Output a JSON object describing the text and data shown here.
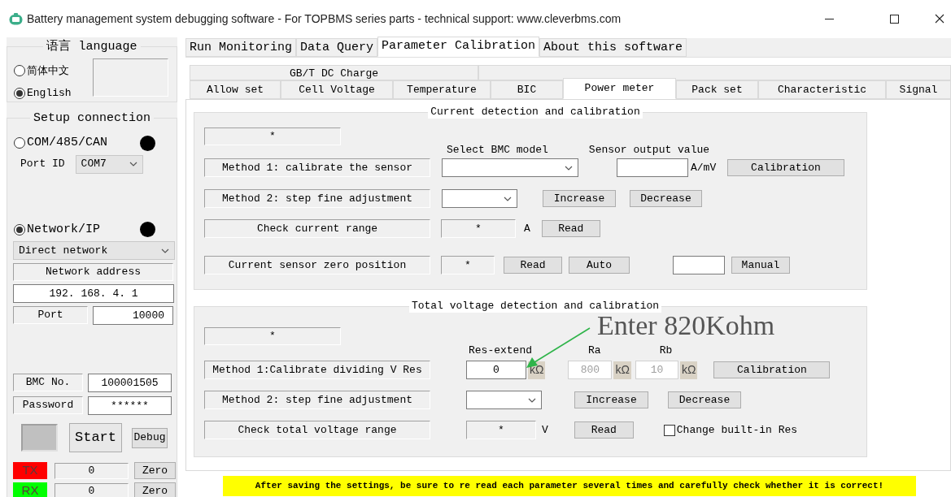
{
  "window": {
    "title": "Battery management system debugging software - For TOPBMS series parts - technical support: www.cleverbms.com"
  },
  "language": {
    "title": "语言 language",
    "options": [
      {
        "label": "简体中文",
        "selected": false
      },
      {
        "label": "English",
        "selected": true
      }
    ]
  },
  "connection": {
    "title": "Setup connection",
    "modes": [
      {
        "label": "COM/485/CAN",
        "selected": false
      },
      {
        "label": "Network/IP",
        "selected": true
      }
    ],
    "port_id_label": "Port ID",
    "port_id": "COM7",
    "network_type": "Direct network",
    "network_address_label": "Network address",
    "network_address": "192. 168. 4. 1",
    "port_label": "Port",
    "port": "10000",
    "bmc_no_label": "BMC No.",
    "bmc_no": "100001505",
    "password_label": "Password",
    "password": "******",
    "start": "Start",
    "debug": "Debug",
    "counters": [
      {
        "label": "TX",
        "color": "#ff0000",
        "value": "0",
        "button": "Zero"
      },
      {
        "label": "RX",
        "color": "#00ff00",
        "value": "0",
        "button": "Zero"
      }
    ]
  },
  "tabs": [
    {
      "label": "Run Monitoring",
      "selected": false
    },
    {
      "label": "Data Query",
      "selected": false
    },
    {
      "label": "Parameter Calibration",
      "selected": true
    },
    {
      "label": "About this software",
      "selected": false
    }
  ],
  "subtabs_top": [
    {
      "label": "GB/T DC Charge",
      "selected": false
    }
  ],
  "subtabs": [
    {
      "label": "Allow set",
      "selected": false
    },
    {
      "label": "Cell Voltage",
      "selected": false
    },
    {
      "label": "Temperature",
      "selected": false
    },
    {
      "label": "BIC",
      "selected": false
    },
    {
      "label": "Power meter",
      "selected": true
    },
    {
      "label": "Pack set",
      "selected": false
    },
    {
      "label": "Characteristic",
      "selected": false
    },
    {
      "label": "Signal",
      "selected": false
    }
  ],
  "current": {
    "title": "Current detection and calibration",
    "status": "*",
    "model_label": "Select BMC model",
    "sensor_label": "Sensor output value",
    "method1": {
      "label": "Method 1: calibrate the sensor",
      "unit": "A/mV",
      "button": "Calibration"
    },
    "method2": {
      "label": "Method 2: step fine adjustment",
      "increase": "Increase",
      "decrease": "Decrease"
    },
    "range": {
      "label": "Check current range",
      "value": "*",
      "unit": "A",
      "button": "Read"
    },
    "zero": {
      "label": "Current sensor zero position",
      "value": "*",
      "read": "Read",
      "auto": "Auto",
      "manual": "Manual"
    }
  },
  "voltage": {
    "title": "Total voltage detection and calibration",
    "status": "*",
    "res_extend_label": "Res-extend",
    "ra_label": "Ra",
    "rb_label": "Rb",
    "method1": {
      "label": "Method 1:Calibrate dividing V Res",
      "res_extend": {
        "value": "0",
        "unit": "kΩ",
        "disabled": false
      },
      "ra": {
        "value": "800",
        "unit": "kΩ",
        "disabled": true
      },
      "rb": {
        "value": "10",
        "unit": "kΩ",
        "disabled": true
      },
      "button": "Calibration"
    },
    "method2": {
      "label": "Method 2: step fine adjustment",
      "increase": "Increase",
      "decrease": "Decrease"
    },
    "range": {
      "label": "Check total voltage range",
      "value": "*",
      "unit": "V",
      "button": "Read"
    },
    "builtin": {
      "label": "Change built-in Res",
      "checked": false
    }
  },
  "annotation": {
    "text": "Enter 820Kohm"
  },
  "notice": "After saving the settings, be sure to re read each parameter several times and carefully check whether it is correct!"
}
